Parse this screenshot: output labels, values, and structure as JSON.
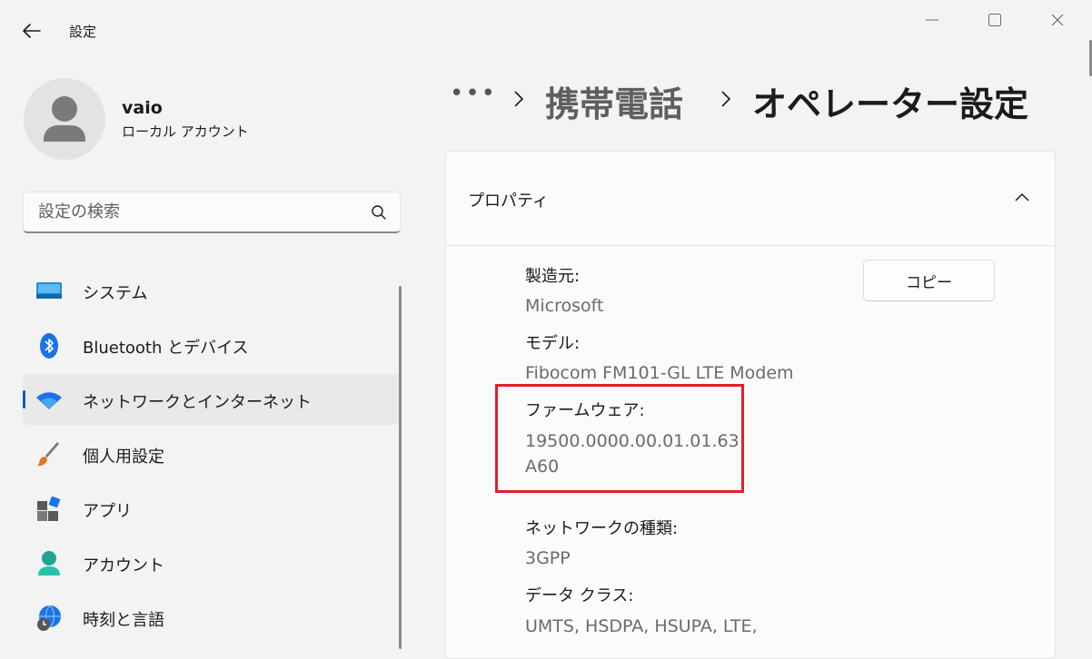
{
  "window": {
    "app_title": "設定"
  },
  "profile": {
    "name": "vaio",
    "account_type": "ローカル アカウント"
  },
  "search": {
    "placeholder": "設定の検索"
  },
  "nav": {
    "items": [
      {
        "label": "システム",
        "icon": "system-display-icon"
      },
      {
        "label": "Bluetooth とデバイス",
        "icon": "bluetooth-icon"
      },
      {
        "label": "ネットワークとインターネット",
        "icon": "wifi-icon",
        "active": true
      },
      {
        "label": "個人用設定",
        "icon": "paintbrush-icon"
      },
      {
        "label": "アプリ",
        "icon": "apps-icon"
      },
      {
        "label": "アカウント",
        "icon": "account-icon"
      },
      {
        "label": "時刻と言語",
        "icon": "globe-clock-icon"
      }
    ]
  },
  "breadcrumb": {
    "overflow": "•••",
    "parent": "携帯電話",
    "current": "オペレーター設定"
  },
  "properties": {
    "title": "プロパティ",
    "copy_label": "コピー",
    "manufacturer_label": "製造元:",
    "manufacturer_value": "Microsoft",
    "model_label": "モデル:",
    "model_value": "Fibocom FM101-GL LTE Modem",
    "firmware_label": "ファームウェア:",
    "firmware_value_line1": "19500.0000.00.01.01.63",
    "firmware_value_line2": "A60",
    "network_type_label": "ネットワークの種類:",
    "network_type_value": "3GPP",
    "data_class_label": "データ クラス:",
    "data_class_value": "UMTS, HSDPA, HSUPA, LTE,"
  },
  "colors": {
    "accent": "#005fb8",
    "highlight": "#e0202d"
  }
}
